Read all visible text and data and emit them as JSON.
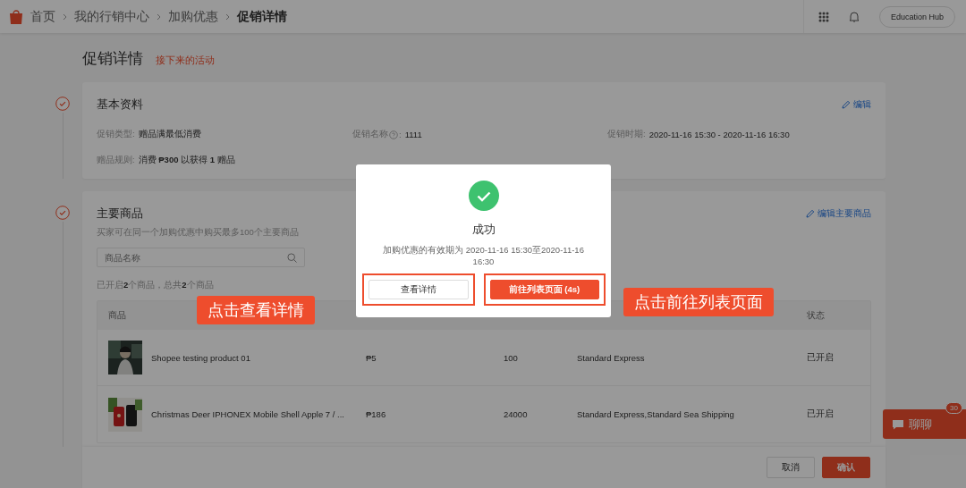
{
  "breadcrumb": [
    {
      "label": "首页",
      "current": false
    },
    {
      "label": "我的行销中心",
      "current": false
    },
    {
      "label": "加购优惠",
      "current": false
    },
    {
      "label": "促销详情",
      "current": true
    }
  ],
  "header": {
    "account_button": "Education Hub"
  },
  "page_title": "促销详情",
  "status_tag": "接下来的活动",
  "basic_info": {
    "title": "基本资料",
    "done": true,
    "edit_link": "编辑",
    "fields": [
      {
        "label": "促销类型",
        "help": false,
        "colon": ":",
        "value": "赠品满最低消费"
      },
      {
        "label": "促销名称",
        "help": true,
        "colon": ":",
        "value": "1111"
      },
      {
        "label": "促销时期",
        "help": false,
        "colon": ":",
        "value": "2020-11-16 15:30 - 2020-11-16 16:30"
      },
      {
        "label": "赠品规则",
        "help": false,
        "colon": ":",
        "value": "消费 **₱300** 以获得 **1** 赠品"
      }
    ]
  },
  "main_products": {
    "title": "主要商品",
    "done": true,
    "edit_link": "编辑主要商品",
    "subtitle": "买家可在同一个加购优惠中购买最多100个主要商品",
    "search": {
      "placeholder": "商品名称"
    },
    "count_text": "已开启**2**个商品，总共**2**个商品",
    "table_header": {
      "product": "商品",
      "status": "状态"
    },
    "rows": [
      {
        "name": "Shopee testing product 01",
        "price": "₱5",
        "stock": "100",
        "shipping": "Standard Express",
        "status": "已开启"
      },
      {
        "name": "Christmas Deer IPHONEX Mobile Shell Apple 7 / ...",
        "price": "₱186",
        "stock": "24000",
        "shipping": "Standard Express,Standard Sea Shipping",
        "status": "已开启"
      }
    ]
  },
  "footer_buttons": [
    {
      "label": "取消",
      "kind": "secondary"
    },
    {
      "label": "确认",
      "kind": "primary"
    }
  ],
  "chat": {
    "label": "聊聊",
    "badge": "30"
  },
  "modal": {
    "title": "成功",
    "message": "加购优惠的有效期为 2020-11-16 15:30至2020-11-16 16:30",
    "buttons": [
      {
        "label": "查看详情",
        "kind": "secondary",
        "highlighted": true
      },
      {
        "label": "前往列表页面 (4s)",
        "kind": "primary",
        "highlighted": true
      }
    ]
  },
  "annotations": [
    {
      "text": "点击查看详情"
    },
    {
      "text": "点击前往列表页面"
    }
  ]
}
